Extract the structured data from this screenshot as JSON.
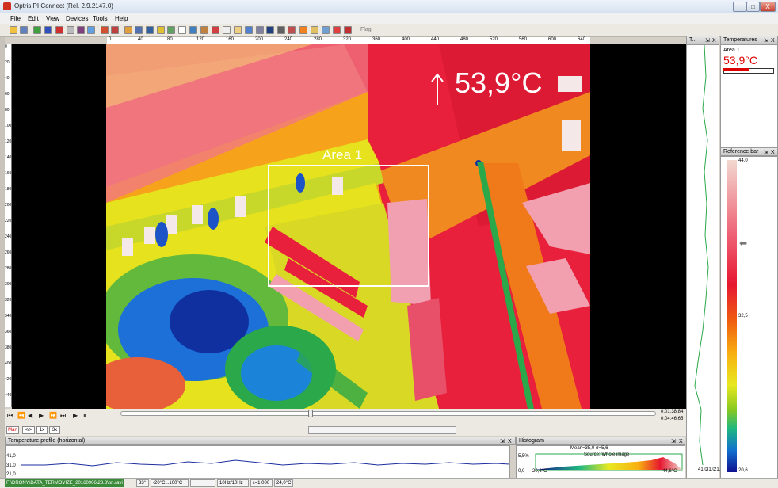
{
  "window": {
    "title": "Optris PI Connect (Rel. 2.9.2147.0)",
    "min": "_",
    "max": "□",
    "close": "X"
  },
  "menu": [
    "File",
    "Edit",
    "View",
    "Devices",
    "Tools",
    "Help"
  ],
  "toolbar": {
    "flag_label": "Flag"
  },
  "ruler_top": [
    "0",
    "40",
    "80",
    "120",
    "160",
    "200",
    "240",
    "280",
    "320",
    "360",
    "400",
    "440",
    "480",
    "520",
    "560",
    "600",
    "640"
  ],
  "ruler_left": [
    "0",
    "20",
    "40",
    "60",
    "80",
    "100",
    "120",
    "140",
    "160",
    "180",
    "200",
    "220",
    "240",
    "260",
    "280",
    "300",
    "320",
    "340",
    "360",
    "380",
    "400",
    "420",
    "440"
  ],
  "image": {
    "max_temperature": "53,9°C",
    "area_label": "Area 1",
    "colors": {
      "hot": "#e8203c",
      "warm": "#f7a21b",
      "mid": "#e6e21d",
      "cool": "#2aa84a",
      "cold": "#1c54c8"
    }
  },
  "playback": {
    "buttons": [
      "⏮",
      "⏪",
      "◀",
      "▶",
      "⏩",
      "⏭",
      "▶",
      "⏸"
    ],
    "progress": 0.35,
    "time_current": "0:01:38,84",
    "time_total": "0:04:46,65",
    "mode_buttons": [
      "Man",
      "</>",
      "1x",
      "3x"
    ]
  },
  "profile_panel": {
    "title": "Temperature profile (horizontal)",
    "y_labels": [
      "41,0",
      "31,0",
      "21,0"
    ],
    "controls": [
      "⇲",
      "X"
    ]
  },
  "histogram_panel": {
    "title": "Histogram",
    "stats": "Mean=35,0 σ=5,6",
    "source": "Source: Whole image",
    "pct": "5,5%",
    "lo": "0,0",
    "x_min": "20,6°C",
    "x_max": "44,6°C",
    "controls": [
      "⇲",
      "X"
    ]
  },
  "vprofile_panel": {
    "title": "T...",
    "controls": [
      "⇲",
      "X"
    ],
    "x_labels": [
      "41,0",
      "31,0",
      "21,0"
    ]
  },
  "temperature_panel": {
    "title": "Temperatures",
    "controls": [
      "⇲",
      "X"
    ],
    "area_name": "Area 1",
    "area_temp": "53,9°C",
    "area_bar": 0.5
  },
  "reference_panel": {
    "title": "Reference bar",
    "controls": [
      "⇲",
      "X"
    ],
    "max": "44,0",
    "mid": "32,5",
    "min": "20,6"
  },
  "status": {
    "file": "F:\\DRONY\\DATA_TERMOVIZE_20160906\\28.8\\pn.ravi",
    "cells": [
      "33°",
      "-20°C...100°C",
      "",
      "10Hz/10Hz",
      "ε=1,000",
      "24,0°C"
    ]
  }
}
